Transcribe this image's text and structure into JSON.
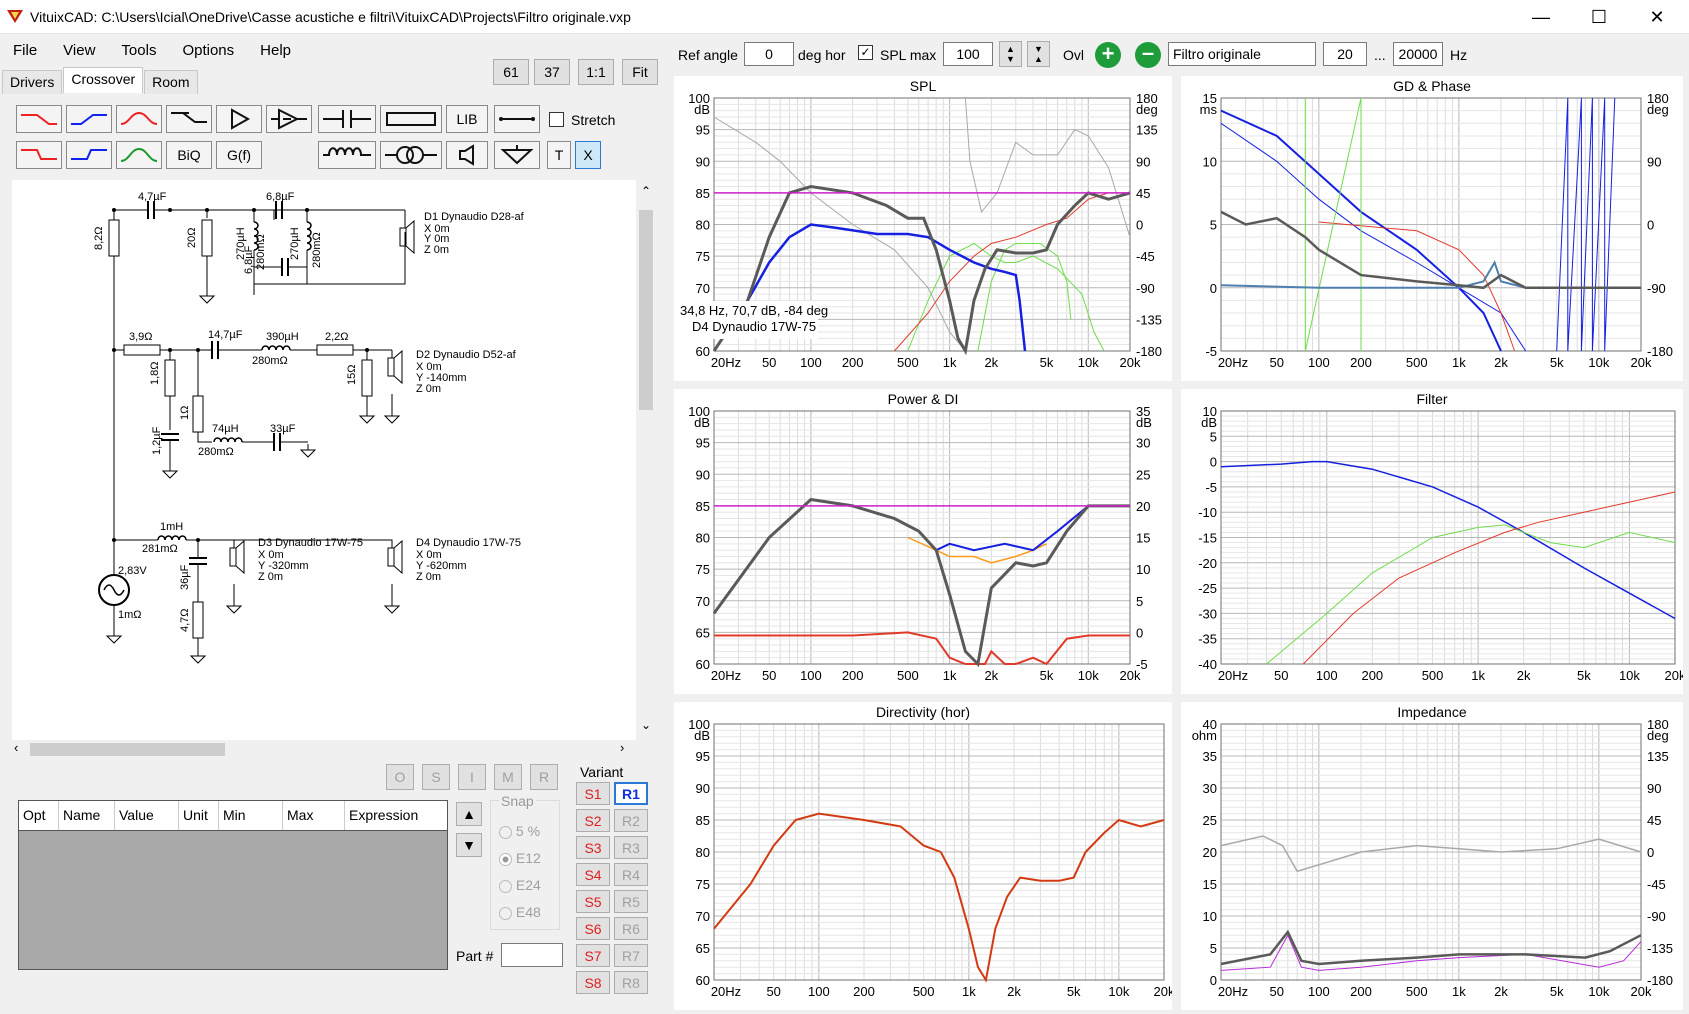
{
  "app": {
    "title": "VituixCAD: C:\\Users\\Icial\\OneDrive\\Casse acustiche e filtri\\VituixCAD\\Projects\\Filtro originale.vxp"
  },
  "menu": [
    "File",
    "View",
    "Tools",
    "Options",
    "Help"
  ],
  "tabs": [
    "Drivers",
    "Crossover",
    "Room"
  ],
  "zoom_buttons": [
    "61",
    "37",
    "1:1",
    "Fit"
  ],
  "toolbar": {
    "biq": "BiQ",
    "gf": "G(f)",
    "lib": "LIB",
    "t": "T",
    "x": "X",
    "stretch": "Stretch"
  },
  "schematic": {
    "labels": [
      "4,7µF",
      "6,8µF",
      "8,2Ω",
      "20Ω",
      "270µH",
      "280mΩ",
      "270µH",
      "280mΩ",
      "6,8µF",
      "D1 Dynaudio D28-af",
      "X 0m",
      "Y 0m",
      "Z 0m",
      "3,9Ω",
      "14,7µF",
      "390µH",
      "280mΩ",
      "2,2Ω",
      "1,8Ω",
      "15Ω",
      "D2 Dynaudio D52-af",
      "X 0m",
      "Y -140mm",
      "Z 0m",
      "1Ω",
      "1,2µF",
      "74µH",
      "280mΩ",
      "33µF",
      "1mH",
      "281mΩ",
      "36µF",
      "4,7Ω",
      "2,83V",
      "1mΩ",
      "D3 Dynaudio 17W-75",
      "X 0m",
      "Y -320mm",
      "Z 0m",
      "D4 Dynaudio 17W-75",
      "X 0m",
      "Y -620mm",
      "Z 0m"
    ]
  },
  "opt_buttons": [
    "O",
    "S",
    "I",
    "M",
    "R"
  ],
  "table": {
    "columns": [
      "Opt",
      "Name",
      "Value",
      "Unit",
      "Min",
      "Max",
      "Expression"
    ]
  },
  "snap": {
    "title": "Snap",
    "options": [
      "5 %",
      "E12",
      "E24",
      "E48"
    ],
    "selected": "E12"
  },
  "part_label": "Part #",
  "variant": {
    "title": "Variant",
    "s": [
      "S1",
      "S2",
      "S3",
      "S4",
      "S5",
      "S6",
      "S7",
      "S8"
    ],
    "r": [
      "R1",
      "R2",
      "R3",
      "R4",
      "R5",
      "R6",
      "R7",
      "R8"
    ],
    "active": "R1"
  },
  "topbar": {
    "ref_angle_label": "Ref angle",
    "ref_angle": "0",
    "deg_hor": "deg hor",
    "spl_max_label": "SPL max",
    "spl_max": "100",
    "ovl": "Ovl",
    "filter_name": "Filtro originale",
    "f_from": "20",
    "dots": "...",
    "f_to": "20000",
    "hz": "Hz",
    "colors": {
      "plus": "#1e9c3a",
      "minus": "#1e9c3a"
    }
  },
  "plots": {
    "spl": {
      "title": "SPL",
      "y_unit": "dB",
      "y2_unit": "deg",
      "y_ticks": [
        "100",
        "95",
        "90",
        "85",
        "80",
        "75",
        "70",
        "65",
        "60"
      ],
      "y2_ticks": [
        "180",
        "135",
        "90",
        "45",
        "0",
        "-45",
        "-90",
        "-135",
        "-180"
      ],
      "cursor_text": "34,8 Hz, 70,7 dB, -84 deg",
      "cursor_driver": "D4 Dynaudio 17W-75"
    },
    "gd": {
      "title": "GD & Phase",
      "y_unit": "ms",
      "y2_unit": "deg",
      "y_ticks": [
        "15",
        "10",
        "5",
        "0",
        "-5"
      ],
      "y2_ticks": [
        "180",
        "90",
        "0",
        "-90",
        "-180"
      ]
    },
    "power": {
      "title": "Power & DI",
      "y_unit": "dB",
      "y2_unit": "dB",
      "y_ticks": [
        "100",
        "95",
        "90",
        "85",
        "80",
        "75",
        "70",
        "65",
        "60"
      ],
      "y2_ticks": [
        "35",
        "30",
        "25",
        "20",
        "15",
        "10",
        "5",
        "0",
        "-5"
      ]
    },
    "filter": {
      "title": "Filter",
      "y_unit": "dB",
      "y_ticks": [
        "10",
        "5",
        "0",
        "-5",
        "-10",
        "-15",
        "-20",
        "-25",
        "-30",
        "-35",
        "-40"
      ]
    },
    "directivity": {
      "title": "Directivity (hor)",
      "y_unit": "dB",
      "y_ticks": [
        "100",
        "95",
        "90",
        "85",
        "80",
        "75",
        "70",
        "65",
        "60"
      ]
    },
    "impedance": {
      "title": "Impedance",
      "y_unit": "ohm",
      "y2_unit": "deg",
      "y_ticks": [
        "40",
        "35",
        "30",
        "25",
        "20",
        "15",
        "10",
        "5",
        "0"
      ],
      "y2_ticks": [
        "180",
        "135",
        "90",
        "45",
        "0",
        "-45",
        "-90",
        "-135",
        "-180"
      ]
    },
    "x_ticks": [
      "20Hz",
      "50",
      "100",
      "200",
      "500",
      "1k",
      "2k",
      "5k",
      "10k",
      "20k"
    ],
    "colors": {
      "magenta": "#cc22cc",
      "gray": "#5a5a58",
      "blue": "#1520e0",
      "green": "#6fdc4a",
      "red": "#e23a2a",
      "orange": "#ff9a1a",
      "lightgray": "#a8a8a8",
      "purple": "#b52ad6",
      "steelblue": "#4f7fb0",
      "dirred": "#d23a12"
    }
  }
}
